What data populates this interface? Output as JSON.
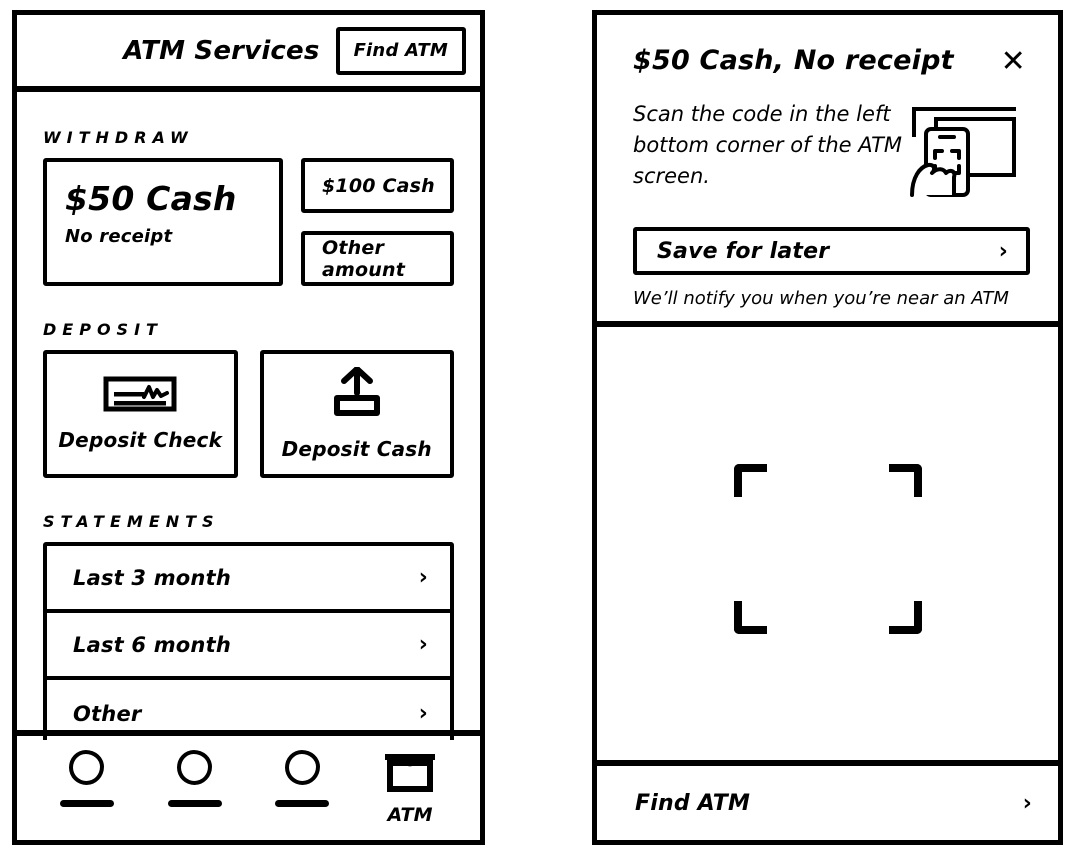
{
  "left_phone": {
    "header": {
      "title": "ATM Services",
      "find_atm_button": "Find ATM"
    },
    "withdraw": {
      "section_label": "WITHDRAW",
      "primary": {
        "amount": "$50 Cash",
        "subtitle": "No receipt"
      },
      "options": [
        {
          "label": "$100 Cash"
        },
        {
          "label": "Other amount"
        }
      ]
    },
    "deposit": {
      "section_label": "DEPOSIT",
      "cards": [
        {
          "label": "Deposit Check",
          "icon": "check-icon"
        },
        {
          "label": "Deposit Cash",
          "icon": "cash-deposit-icon"
        }
      ]
    },
    "statements": {
      "section_label": "STATEMENTS",
      "rows": [
        {
          "label": "Last 3 month",
          "chevron": "›"
        },
        {
          "label": "Last 6 month",
          "chevron": "›"
        },
        {
          "label": "Other",
          "chevron": "›"
        }
      ]
    },
    "tabbar": {
      "items": [
        {
          "label": "",
          "icon": "placeholder-blob-icon"
        },
        {
          "label": "",
          "icon": "placeholder-blob-icon"
        },
        {
          "label": "",
          "icon": "placeholder-blob-icon"
        },
        {
          "label": "ATM",
          "icon": "atm-machine-icon"
        }
      ]
    }
  },
  "right_phone": {
    "title": "$50 Cash, No receipt",
    "close_icon": "✕",
    "instructions": "Scan the code in the left bottom corner of the ATM screen.",
    "illustration": "hand-holding-phone-scanning-screen-icon",
    "save_button": {
      "label": "Save for later",
      "chevron": "›"
    },
    "save_hint": "We’ll notify you when you’re near an ATM",
    "scanner": {
      "viewfinder": "scan-viewfinder-brackets"
    },
    "bottom_action": {
      "label": "Find ATM",
      "chevron": "›"
    }
  },
  "colors": {
    "ink": "#000000",
    "paper": "#ffffff"
  }
}
